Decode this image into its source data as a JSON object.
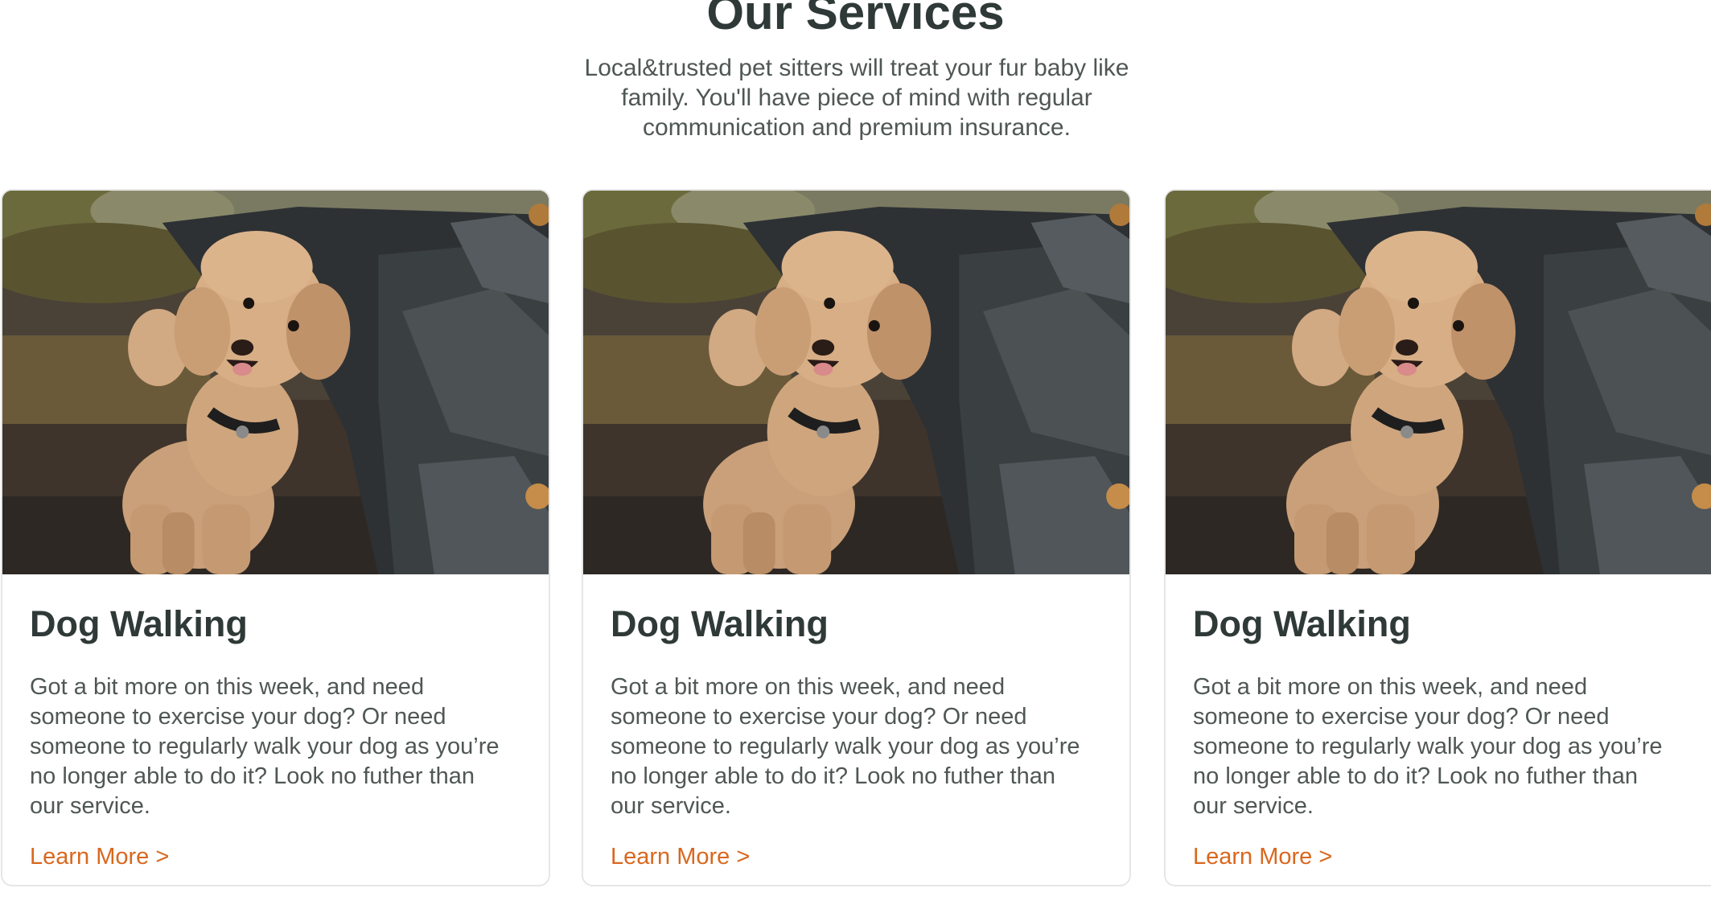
{
  "section": {
    "title": "Our Services",
    "subtitle": "Local&trusted pet sitters will treat your fur baby like family. You'll have piece of mind with regular communication and premium insurance."
  },
  "cards": [
    {
      "title": "Dog Walking",
      "text": "Got a bit more on this week, and need someone to exercise your dog? Or need someone to regularly walk your dog as you’re no longer able to do it? Look no futher than our service.",
      "link": "Learn More >",
      "image": "poodle-photo"
    },
    {
      "title": "Dog Walking",
      "text": "Got a bit more on this week, and need someone to exercise your dog? Or need someone to regularly walk your dog as you’re no longer able to do it? Look no futher than our service.",
      "link": "Learn More >",
      "image": "poodle-photo"
    },
    {
      "title": "Dog Walking",
      "text": "Got a bit more on this week, and need someone to exercise your dog? Or need someone to regularly walk your dog as you’re no longer able to do it? Look no futher than our service.",
      "link": "Learn More >",
      "image": "poodle-photo"
    }
  ],
  "colors": {
    "heading": "#2f3a38",
    "body_text": "#4f5755",
    "link": "#d8681f",
    "card_border": "#e6e6e6"
  }
}
